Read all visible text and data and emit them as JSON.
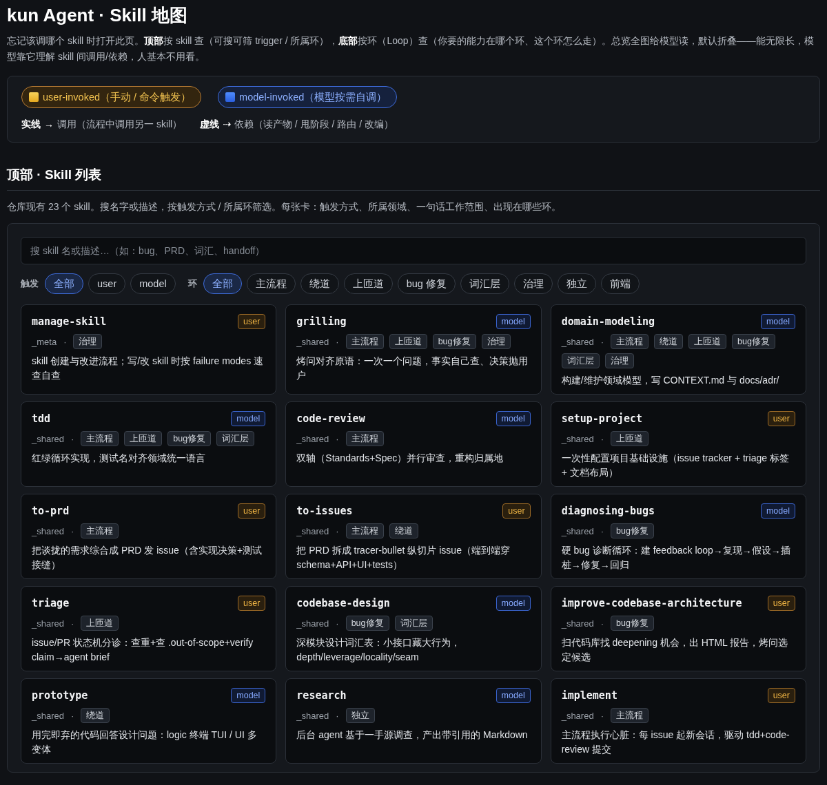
{
  "page": {
    "title": "kun Agent · Skill 地图",
    "intro": "忘记该调哪个 skill 时打开此页。**顶部**按 skill 查（可搜可筛 trigger / 所属环），**底部**按环（Loop）查（你要的能力在哪个环、这个环怎么走）。总览全图给模型读，默认折叠——能无限长，模型靠它理解 skill 间调用/依赖，人基本不用看。"
  },
  "legend": {
    "badges": [
      {
        "kind": "user",
        "label": "user-invoked（手动 / 命令触发）"
      },
      {
        "kind": "model",
        "label": "model-invoked（模型按需自调）"
      }
    ],
    "lines": [
      {
        "term": "实线",
        "arrow": "→",
        "text": "调用（流程中调用另一 skill）"
      },
      {
        "term": "虚线",
        "arrow": "⇢",
        "text": "依赖（读产物 / 甩阶段 / 路由 / 改编）"
      }
    ]
  },
  "section": {
    "title": "顶部 · Skill 列表",
    "subtitle": "仓库现有 23 个 skill。搜名字或描述，按触发方式 / 所属环筛选。每张卡：触发方式、所属领域、一句话工作范围、出现在哪些环。"
  },
  "search": {
    "placeholder": "搜 skill 名或描述…（如：bug、PRD、词汇、handoff）"
  },
  "filters": [
    {
      "label": "触发",
      "options": [
        {
          "label": "全部",
          "selected": true
        },
        {
          "label": "user",
          "selected": false
        },
        {
          "label": "model",
          "selected": false
        }
      ]
    },
    {
      "label": "环",
      "options": [
        {
          "label": "全部",
          "selected": true
        },
        {
          "label": "主流程",
          "selected": false
        },
        {
          "label": "绕道",
          "selected": false
        },
        {
          "label": "上匝道",
          "selected": false
        },
        {
          "label": "bug 修复",
          "selected": false
        },
        {
          "label": "词汇层",
          "selected": false
        },
        {
          "label": "治理",
          "selected": false
        },
        {
          "label": "独立",
          "selected": false
        },
        {
          "label": "前端",
          "selected": false
        }
      ]
    }
  ],
  "cards": [
    {
      "name": "manage-skill",
      "badge": {
        "kind": "user",
        "label": "user"
      },
      "domain": "_meta",
      "separator": "·",
      "loops": [
        "治理"
      ],
      "description": "skill 创建与改进流程；写/改 skill 时按 failure modes 速查自查"
    },
    {
      "name": "grilling",
      "badge": {
        "kind": "model",
        "label": "model"
      },
      "domain": "_shared",
      "separator": "·",
      "loops": [
        "主流程",
        "上匝道",
        "bug修复",
        "治理"
      ],
      "description": "烤问对齐原语：一次一个问题，事实自己查、决策抛用户"
    },
    {
      "name": "domain-modeling",
      "badge": {
        "kind": "model",
        "label": "model"
      },
      "domain": "_shared",
      "separator": "·",
      "loops": [
        "主流程",
        "绕道",
        "上匝道",
        "bug修复",
        "词汇层",
        "治理"
      ],
      "description": "构建/维护领域模型，写 CONTEXT.md 与 docs/adr/"
    },
    {
      "name": "tdd",
      "badge": {
        "kind": "model",
        "label": "model"
      },
      "domain": "_shared",
      "separator": "·",
      "loops": [
        "主流程",
        "上匝道",
        "bug修复",
        "词汇层"
      ],
      "description": "红绿循环实现，测试名对齐领域统一语言"
    },
    {
      "name": "code-review",
      "badge": {
        "kind": "model",
        "label": "model"
      },
      "domain": "_shared",
      "separator": "·",
      "loops": [
        "主流程"
      ],
      "description": "双轴（Standards+Spec）并行审查，重构归属地"
    },
    {
      "name": "setup-project",
      "badge": {
        "kind": "user",
        "label": "user"
      },
      "domain": "_shared",
      "separator": "·",
      "loops": [
        "上匝道"
      ],
      "description": "一次性配置项目基础设施（issue tracker + triage 标签 + 文档布局）"
    },
    {
      "name": "to-prd",
      "badge": {
        "kind": "user",
        "label": "user"
      },
      "domain": "_shared",
      "separator": "·",
      "loops": [
        "主流程"
      ],
      "description": "把谈拢的需求综合成 PRD 发 issue（含实现决策+测试接缝）"
    },
    {
      "name": "to-issues",
      "badge": {
        "kind": "user",
        "label": "user"
      },
      "domain": "_shared",
      "separator": "·",
      "loops": [
        "主流程",
        "绕道"
      ],
      "description": "把 PRD 拆成 tracer-bullet 纵切片 issue（端到端穿 schema+API+UI+tests）"
    },
    {
      "name": "diagnosing-bugs",
      "badge": {
        "kind": "model",
        "label": "model"
      },
      "domain": "_shared",
      "separator": "·",
      "loops": [
        "bug修复"
      ],
      "description": "硬 bug 诊断循环：建 feedback loop→复现→假设→插桩→修复→回归"
    },
    {
      "name": "triage",
      "badge": {
        "kind": "user",
        "label": "user"
      },
      "domain": "_shared",
      "separator": "·",
      "loops": [
        "上匝道"
      ],
      "description": "issue/PR 状态机分诊：查重+查 .out-of-scope+verify claim→agent brief"
    },
    {
      "name": "codebase-design",
      "badge": {
        "kind": "model",
        "label": "model"
      },
      "domain": "_shared",
      "separator": "·",
      "loops": [
        "bug修复",
        "词汇层"
      ],
      "description": "深模块设计词汇表：小接口藏大行为，depth/leverage/locality/seam"
    },
    {
      "name": "improve-codebase-architecture",
      "badge": {
        "kind": "user",
        "label": "user"
      },
      "domain": "_shared",
      "separator": "·",
      "loops": [
        "bug修复"
      ],
      "description": "扫代码库找 deepening 机会，出 HTML 报告，烤问选定候选"
    },
    {
      "name": "prototype",
      "badge": {
        "kind": "model",
        "label": "model"
      },
      "domain": "_shared",
      "separator": "·",
      "loops": [
        "绕道"
      ],
      "description": "用完即弃的代码回答设计问题：logic 终端 TUI / UI 多变体"
    },
    {
      "name": "research",
      "badge": {
        "kind": "model",
        "label": "model"
      },
      "domain": "_shared",
      "separator": "·",
      "loops": [
        "独立"
      ],
      "description": "后台 agent 基于一手源调查，产出带引用的 Markdown"
    },
    {
      "name": "implement",
      "badge": {
        "kind": "user",
        "label": "user"
      },
      "domain": "_shared",
      "separator": "·",
      "loops": [
        "主流程"
      ],
      "description": "主流程执行心脏：每 issue 起新会话，驱动 tdd+code-review 提交"
    }
  ]
}
